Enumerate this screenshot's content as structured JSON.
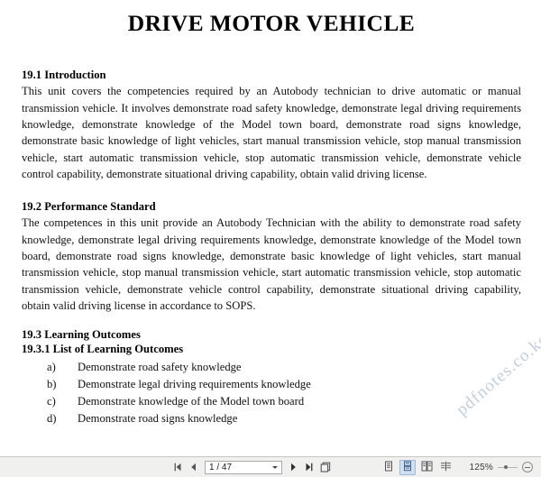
{
  "document": {
    "title": "DRIVE MOTOR VEHICLE",
    "sections": {
      "introduction": {
        "heading": "19.1 Introduction",
        "body": "This unit covers the competencies required by an Autobody technician to drive automatic or manual transmission vehicle. It involves demonstrate road safety knowledge, demonstrate legal driving requirements knowledge, demonstrate knowledge of the Model town board, demonstrate road signs knowledge, demonstrate basic knowledge of light vehicles, start manual transmission vehicle, stop manual transmission vehicle, start automatic transmission vehicle, stop automatic transmission vehicle, demonstrate vehicle control capability, demonstrate situational driving capability, obtain valid driving license."
      },
      "performance_standard": {
        "heading": "19.2 Performance Standard",
        "body": "The competences in this unit provide an Autobody Technician with the ability to demonstrate road safety knowledge, demonstrate legal driving requirements knowledge, demonstrate knowledge of the Model town board, demonstrate road signs knowledge, demonstrate basic knowledge of light vehicles, start manual transmission vehicle, stop manual transmission vehicle, start automatic transmission vehicle, stop automatic transmission vehicle, demonstrate vehicle control capability, demonstrate situational driving capability, obtain valid driving license in accordance to SOPS."
      },
      "learning_outcomes": {
        "heading": "19.3 Learning Outcomes",
        "sub_heading": "19.3.1 List of Learning Outcomes",
        "items": [
          {
            "marker": "a)",
            "text": "Demonstrate road safety knowledge"
          },
          {
            "marker": "b)",
            "text": "Demonstrate legal driving requirements knowledge"
          },
          {
            "marker": "c)",
            "text": "Demonstrate knowledge of the Model town board"
          },
          {
            "marker": "d)",
            "text": "Demonstrate road signs knowledge"
          }
        ]
      }
    },
    "watermark": "pdfnotes.co.ke"
  },
  "toolbar": {
    "first_page_label": "First page",
    "previous_page_label": "Previous page",
    "page_indicator": "1 / 47",
    "next_page_label": "Next page",
    "last_page_label": "Last page",
    "view_single_label": "Single page view",
    "view_continuous_label": "Continuous view",
    "view_facing_label": "Facing pages view",
    "view_book_label": "Book view",
    "zoom_level": "125%",
    "zoom_out_label": "Zoom out"
  },
  "colors": {
    "toolbar_background": "#f0f0ee",
    "toolbar_border": "#c6c6c4",
    "selected_view": "#cfe0f3",
    "watermark": "#b9c6d6",
    "text": "#111111"
  }
}
